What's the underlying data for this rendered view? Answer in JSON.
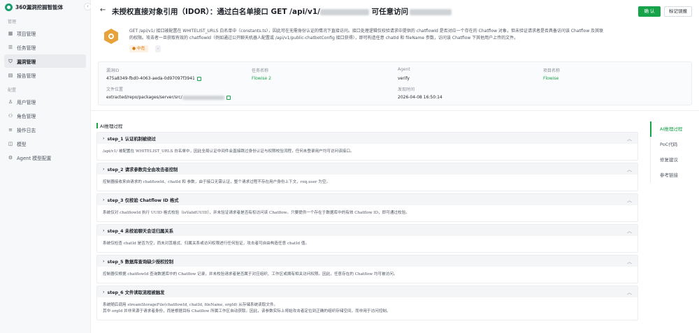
{
  "app": {
    "name": "360漏洞挖掘智能体"
  },
  "sidebar": {
    "section_manage": "管理",
    "section_config": "配置",
    "items": [
      {
        "label": "项目管理",
        "icon": "grid-icon"
      },
      {
        "label": "任务管理",
        "icon": "list-icon"
      },
      {
        "label": "漏洞管理",
        "icon": "shield-icon",
        "active": true
      },
      {
        "label": "报告管理",
        "icon": "report-icon"
      },
      {
        "label": "用户管理",
        "icon": "user-icon"
      },
      {
        "label": "角色管理",
        "icon": "role-icon"
      },
      {
        "label": "操作日志",
        "icon": "log-icon"
      },
      {
        "label": "模型",
        "icon": "cube-icon"
      },
      {
        "label": "Agent 模型配置",
        "icon": "gear-icon"
      }
    ]
  },
  "header": {
    "title_part1": "未授权直接对象引用（IDOR）：通过白名单接口 GET /api/v1/",
    "title_part2": " 可任意访问",
    "confirm_label": "确 认",
    "false_positive_label": "标记误报"
  },
  "vuln": {
    "description_line1": "GET /api/v1/                  接口被配置在 WHITELIST_URLS 白名单中（constants.ts），因此可在无需身份认证的情况下直接访问。接口处理逻辑仅校验请求中提供的 chatflowId 是否对应一个存在的 Chatflow 对象，但未验证请求者是否具备访问该 Chatflow 及其联",
    "description_line2": "                  的权限。攻击者一旦获取有效的 chatflowId（例如通过公开聊天机器人配置或 /api/v1/public-chatbotConfig 接口获得），即可构造任意 chatId 和 fileName 参数，访问该 Chatflow 下其他用户上传的文件。",
    "severity": "中危",
    "extra_tag": "-"
  },
  "meta": {
    "vuln_id_label": "漏洞ID",
    "vuln_id": "475a8349-fbd0-4063-aeda-0d97097f3941",
    "task_label": "任务名称",
    "task": "Flowise 2",
    "agent_label": "Agent",
    "agent": "verify",
    "project_label": "项目名称",
    "project": "Flowise",
    "file_label": "文件位置",
    "file": "extracted/repo/packages/server/src/",
    "found_label": "发现时间",
    "found": "2026-04-08 16:50:14"
  },
  "ai": {
    "section_title": "AI推理过程",
    "steps": [
      {
        "title": "step_1 认证机制被绕过",
        "body": "/api/v1/                  被配置在 WHITELIST_URLS 白名单中，因此全局认证中间件会直接跳过身份认证与权限校验流程，任何未登录用户均可访问该接口。"
      },
      {
        "title": "step_2 请求参数完全由攻击者控制",
        "body": "控制器接收来自请求的 chatflowId、chatId 和          参数，由于接口无需认证，整个请求过程不存在用户身份上下文，req.user 为空。"
      },
      {
        "title": "step_3 仅校验 Chatflow ID 格式",
        "body": "系统仅对 chatflowId 执行 UUID 格式校验（isValidUUID），并未验证请求者是否有权访问该 Chatflow。只要提供一个存在于数据库中的有效 Chatflow ID，即可通过校验。"
      },
      {
        "title": "step_4 未校验聊天会话归属关系",
        "body": "系统仅检查 chatId 是否为空，而未对其格式、归属关系或访问权限进行任何验证，攻击者可自由构造任意 chatId 值。"
      },
      {
        "title": "step_5 数据库查询缺少授权控制",
        "body": "控制器仅根据 chatflowId 查询数据库中的 Chatflow 记录，并未校验请求者是否属于对应组织、工作区或拥有相关访问权限。因此，任意存在的 Chatflow 均可被访问。"
      },
      {
        "title": "step_6 文件读取流程被触发",
        "body": "系统随后调用 streamStorageFile(chatflowId, chatId, fileName, orgId) 从存储系统读取文件。",
        "body2": "其中 orgId 并非来源于请求者身份，而是根据目标 Chatflow 所属工作区自动获取。因此，该参数实际上将始攻击者定位到正确的组织存储空间，而非用于访问控制。"
      }
    ]
  },
  "toc": [
    {
      "label": "AI推理过程",
      "active": true
    },
    {
      "label": "PoC代码"
    },
    {
      "label": "修复建议"
    },
    {
      "label": "参考链接"
    }
  ],
  "colors": {
    "accent": "#16a34a",
    "severity_mid": "#d97706"
  }
}
